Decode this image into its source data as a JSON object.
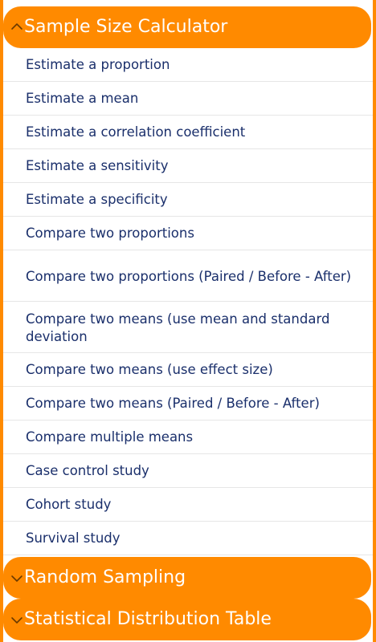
{
  "sections": {
    "sample_size": {
      "title": "Sample Size Calculator",
      "items": [
        {
          "label": "Estimate a proportion"
        },
        {
          "label": "Estimate a mean"
        },
        {
          "label": "Estimate a correlation coefficient"
        },
        {
          "label": "Estimate a sensitivity"
        },
        {
          "label": "Estimate a specificity"
        },
        {
          "label": "Compare two proportions"
        },
        {
          "label": "Compare two proportions (Paired / Before - After)"
        },
        {
          "label": "Compare two means (use mean and standard deviation"
        },
        {
          "label": "Compare two means (use effect size)"
        },
        {
          "label": "Compare two means (Paired / Before - After)"
        },
        {
          "label": "Compare multiple means"
        },
        {
          "label": "Case control study"
        },
        {
          "label": "Cohort study"
        },
        {
          "label": "Survival study"
        }
      ]
    },
    "random_sampling": {
      "title": "Random Sampling"
    },
    "statistical_distribution": {
      "title": "Statistical Distribution Table"
    }
  },
  "colors": {
    "accent": "#ff8a00",
    "item_text": "#1a2f6b",
    "divider": "#e6e6e6",
    "background": "#ffffff"
  },
  "icons": {
    "expanded": "chevron-up-icon",
    "collapsed": "chevron-down-icon"
  }
}
